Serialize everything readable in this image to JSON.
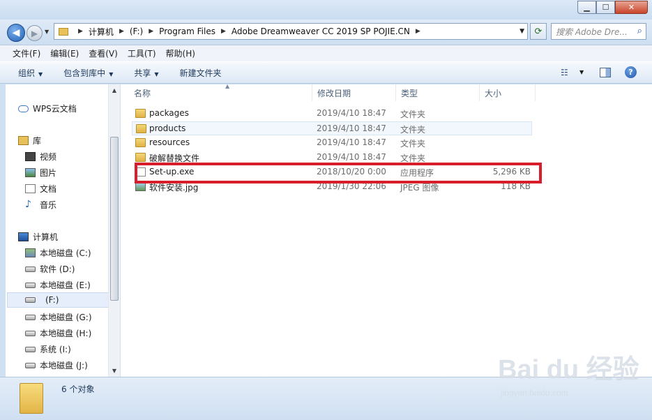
{
  "window": {
    "minimize": "▁",
    "maximize": "☐",
    "close": "✕"
  },
  "address": {
    "crumbs": [
      "计算机",
      "(F:)",
      "Program Files",
      "Adobe Dreamweaver CC 2019 SP POJIE.CN"
    ],
    "search_placeholder": "搜索 Adobe Dre..."
  },
  "menu": [
    "文件(F)",
    "编辑(E)",
    "查看(V)",
    "工具(T)",
    "帮助(H)"
  ],
  "toolbar": {
    "organize": "组织",
    "include_library": "包含到库中",
    "share": "共享",
    "new_folder": "新建文件夹"
  },
  "sidebar": {
    "wps": "WPS云文档",
    "library": "库",
    "library_items": [
      "视频",
      "图片",
      "文档",
      "音乐"
    ],
    "computer": "计算机",
    "drives": [
      "本地磁盘 (C:)",
      "软件 (D:)",
      "本地磁盘 (E:)",
      "(F:)",
      "本地磁盘 (G:)",
      "本地磁盘 (H:)",
      "系统 (I:)",
      "本地磁盘 (J:)"
    ]
  },
  "columns": {
    "name": "名称",
    "date": "修改日期",
    "type": "类型",
    "size": "大小"
  },
  "files": [
    {
      "name": "packages",
      "date": "2019/4/10 18:47",
      "type": "文件夹",
      "size": "",
      "icon": "folder-icon"
    },
    {
      "name": "products",
      "date": "2019/4/10 18:47",
      "type": "文件夹",
      "size": "",
      "icon": "folder-icon"
    },
    {
      "name": "resources",
      "date": "2019/4/10 18:47",
      "type": "文件夹",
      "size": "",
      "icon": "folder-icon"
    },
    {
      "name": "破解替换文件",
      "date": "2019/4/10 18:47",
      "type": "文件夹",
      "size": "",
      "icon": "folder-icon"
    },
    {
      "name": "Set-up.exe",
      "date": "2018/10/20 0:00",
      "type": "应用程序",
      "size": "5,296 KB",
      "icon": "exe-icon"
    },
    {
      "name": "软件安装.jpg",
      "date": "2019/1/30 22:06",
      "type": "JPEG 图像",
      "size": "118 KB",
      "icon": "jpg-icon"
    }
  ],
  "status": {
    "count_text": "6 个对象"
  },
  "watermark": {
    "logo": "Bai du 经验",
    "url": "jingyan.baidu.com"
  },
  "colors": {
    "highlight": "#d81e2a",
    "accent": "#1f5fb4"
  }
}
